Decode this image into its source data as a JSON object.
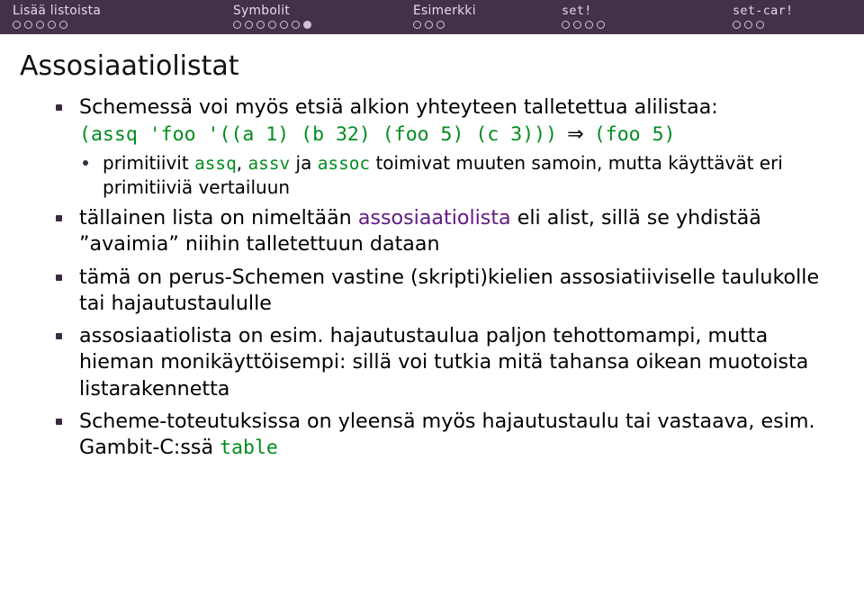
{
  "nav": {
    "sections": [
      {
        "label": "Lisää listoista",
        "mono": false,
        "dots": 5,
        "active_index": -1
      },
      {
        "label": "Symbolit",
        "mono": false,
        "dots": 7,
        "active_index": 6
      },
      {
        "label": "Esimerkki",
        "mono": false,
        "dots": 3,
        "active_index": -1
      },
      {
        "label": "set!",
        "mono": true,
        "dots": 4,
        "active_index": -1
      },
      {
        "label": "set-car!",
        "mono": true,
        "dots": 3,
        "active_index": -1
      }
    ]
  },
  "title": "Assosiaatiolistat",
  "bullets": {
    "b1_a": "Schemessä voi myös etsiä alkion yhteyteen talletettua alilistaa:",
    "b1_code_a": "(assq 'foo '((a 1) (b 32) (foo 5) (c 3)))",
    "b1_arrow": "⇒",
    "b1_code_b": "(foo 5)",
    "b1_sub_a": "primitiivit ",
    "b1_sub_assq": "assq",
    "b1_sub_sep1": ", ",
    "b1_sub_assv": "assv",
    "b1_sub_mid": " ja ",
    "b1_sub_assoc": "assoc",
    "b1_sub_b": " toimivat muuten samoin, mutta käyttävät eri primitiiviä vertailuun",
    "b2_a": "tällainen lista on nimeltään ",
    "b2_term": "assosiaatiolista",
    "b2_b": " eli alist, sillä se yhdistää ”avaimia” niihin talletettuun dataan",
    "b3": "tämä on perus-Schemen vastine (skripti)kielien assosiatiiviselle taulukolle tai hajautustaululle",
    "b4": "assosiaatiolista on esim. hajautustaulua paljon tehottomampi, mutta hieman monikäyttöisempi: sillä voi tutkia mitä tahansa oikean muotoista listarakennetta",
    "b5_a": "Scheme-toteutuksissa on yleensä myös hajautustaulu tai vastaava, esim. Gambit-C:ssä ",
    "b5_code": "table"
  }
}
